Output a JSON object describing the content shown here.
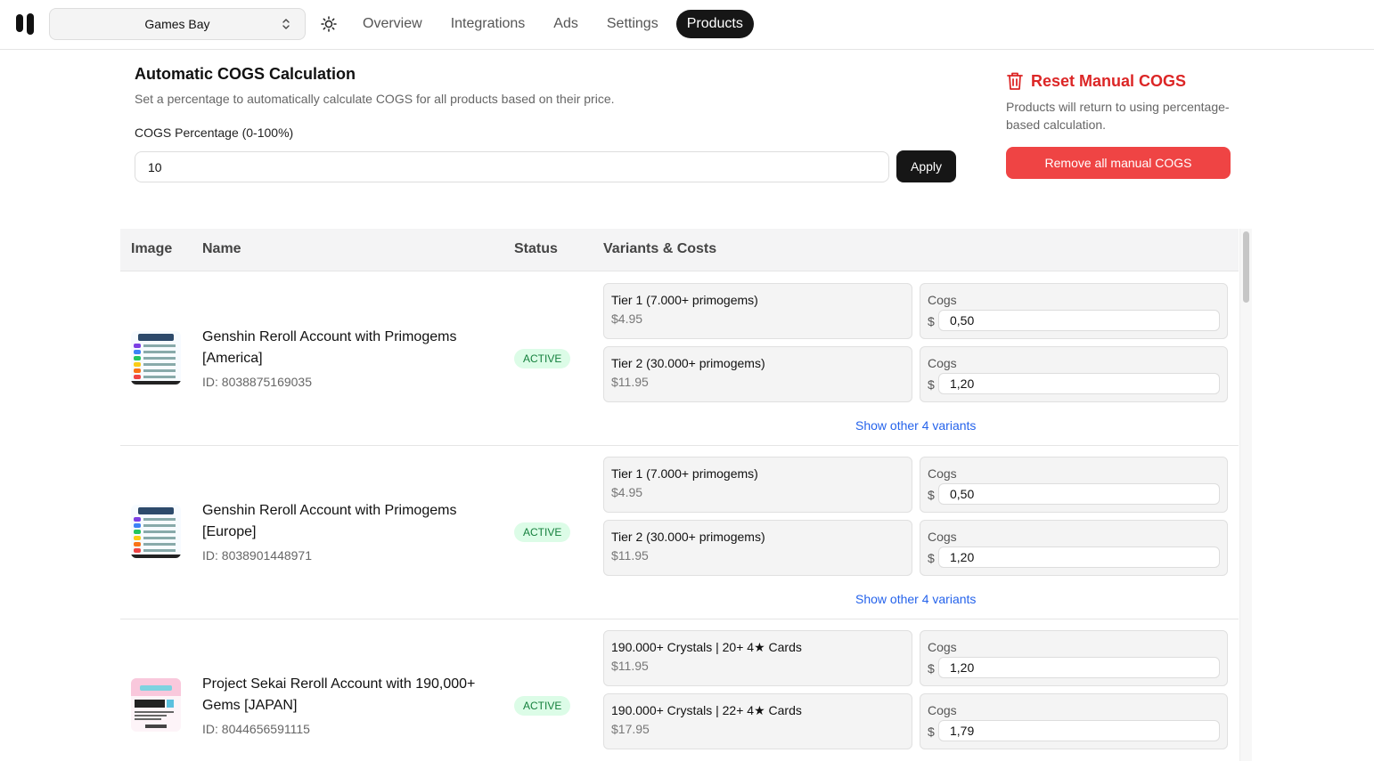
{
  "store": {
    "selected": "Games Bay"
  },
  "nav": [
    {
      "label": "Overview",
      "active": false
    },
    {
      "label": "Integrations",
      "active": false
    },
    {
      "label": "Ads",
      "active": false
    },
    {
      "label": "Settings",
      "active": false
    },
    {
      "label": "Products",
      "active": true
    }
  ],
  "cogs": {
    "title": "Automatic COGS Calculation",
    "description": "Set a percentage to automatically calculate COGS for all products based on their price.",
    "percent_label": "COGS Percentage (0-100%)",
    "percent_value": "10",
    "apply_label": "Apply"
  },
  "reset": {
    "title": "Reset Manual COGS",
    "description": "Products will return to using percentage-based calculation.",
    "button_label": "Remove all manual COGS"
  },
  "table": {
    "headers": {
      "image": "Image",
      "name": "Name",
      "status": "Status",
      "variants": "Variants & Costs"
    },
    "cogs_label": "Cogs",
    "currency": "$",
    "rows": [
      {
        "name": "Genshin Reroll Account with Primogems [America]",
        "id": "ID: 8038875169035",
        "status": "ACTIVE",
        "variants": [
          {
            "name": "Tier 1 (7.000+ primogems)",
            "price": "$4.95",
            "cogs": "0,50"
          },
          {
            "name": "Tier 2 (30.000+ primogems)",
            "price": "$11.95",
            "cogs": "1,20"
          }
        ],
        "show_more": "Show other 4 variants"
      },
      {
        "name": "Genshin Reroll Account with Primogems [Europe]",
        "id": "ID: 8038901448971",
        "status": "ACTIVE",
        "variants": [
          {
            "name": "Tier 1 (7.000+ primogems)",
            "price": "$4.95",
            "cogs": "0,50"
          },
          {
            "name": "Tier 2 (30.000+ primogems)",
            "price": "$11.95",
            "cogs": "1,20"
          }
        ],
        "show_more": "Show other 4 variants"
      },
      {
        "name": "Project Sekai Reroll Account with 190,000+ Gems [JAPAN]",
        "id": "ID: 8044656591115",
        "status": "ACTIVE",
        "variants": [
          {
            "name": "190.000+ Crystals | 20+ 4★ Cards",
            "price": "$11.95",
            "cogs": "1,20"
          },
          {
            "name": "190.000+ Crystals | 22+ 4★ Cards",
            "price": "$17.95",
            "cogs": "1,79"
          }
        ],
        "show_more": ""
      }
    ]
  },
  "colors": {
    "accent_dark": "#161616",
    "danger": "#ef4444",
    "danger_text": "#dc2626",
    "badge_bg": "#dcfce7",
    "badge_text": "#15803d",
    "link": "#2563eb"
  }
}
